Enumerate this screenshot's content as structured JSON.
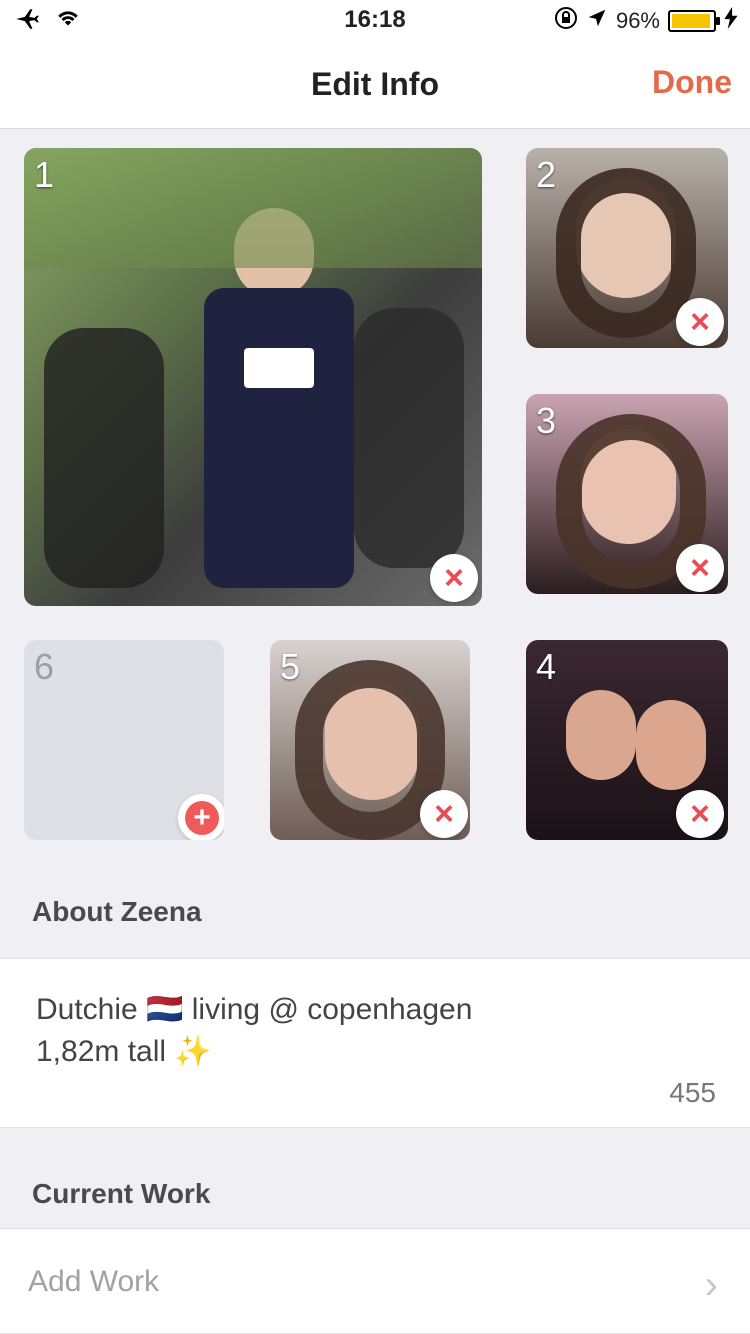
{
  "status_bar": {
    "time": "16:18",
    "battery_percent": "96%",
    "icons": [
      "airplane-icon",
      "wifi-icon",
      "rotation-lock-icon",
      "location-arrow-icon",
      "charging-bolt-icon"
    ]
  },
  "nav": {
    "title": "Edit Info",
    "done_label": "Done",
    "accent": "#e46b4a"
  },
  "photos": [
    {
      "index": "1",
      "remove_icon": "close-icon"
    },
    {
      "index": "2",
      "remove_icon": "close-icon"
    },
    {
      "index": "3",
      "remove_icon": "close-icon"
    },
    {
      "index": "4",
      "remove_icon": "close-icon"
    },
    {
      "index": "5",
      "remove_icon": "close-icon"
    },
    {
      "index": "6",
      "add_icon": "plus-icon",
      "empty": true
    }
  ],
  "about": {
    "title": "About Zeena",
    "bio": "Dutchie 🇳🇱 living @ copenhagen\n1,82m tall ✨",
    "counter": "455"
  },
  "work": {
    "title": "Current Work",
    "placeholder": "Add Work",
    "icon": "chevron-right-icon"
  }
}
